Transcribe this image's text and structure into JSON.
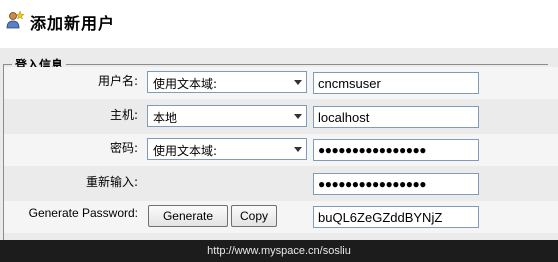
{
  "header": {
    "title": "添加新用户",
    "icon": "add-user-icon"
  },
  "login_section": {
    "legend": "登入信息",
    "username": {
      "label": "用户名:",
      "select_value": "使用文本域:",
      "input_value": "cncmsuser"
    },
    "host": {
      "label": "主机:",
      "select_value": "本地",
      "input_value": "localhost"
    },
    "password": {
      "label": "密码:",
      "select_value": "使用文本域:",
      "input_value": "●●●●●●●●●●●●●●●●"
    },
    "retype": {
      "label": "重新输入:",
      "input_value": "●●●●●●●●●●●●●●●●"
    },
    "generate": {
      "label": "Generate Password:",
      "generate_button": "Generate",
      "copy_button": "Copy",
      "input_value": "buQL6ZeGZddBYNjZ"
    }
  },
  "footer": {
    "watermark": "http://www.myspace.cn/sosliu"
  }
}
